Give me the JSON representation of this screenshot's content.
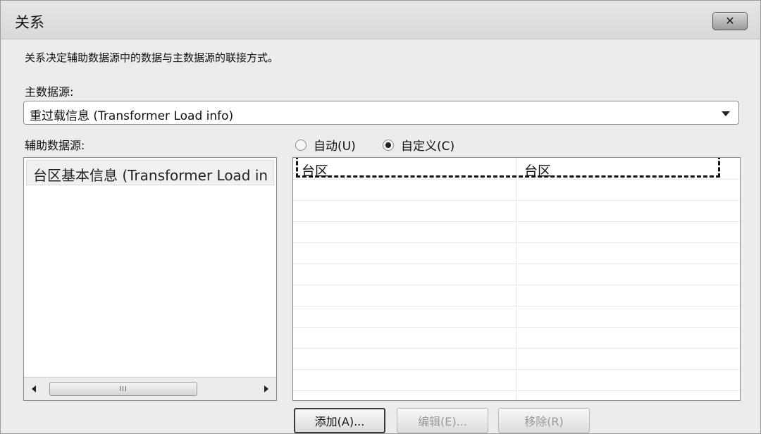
{
  "window": {
    "title": "关系",
    "close_label": "✕"
  },
  "description": "关系决定辅助数据源中的数据与主数据源的联接方式。",
  "primary_source": {
    "label": "主数据源:",
    "value": "重过载信息 (Transformer Load info)"
  },
  "secondary_source": {
    "label": "辅助数据源:",
    "items": [
      {
        "label": "台区基本信息 (Transformer Load in"
      }
    ],
    "scroll_grip": "III"
  },
  "mode": {
    "auto_label": "自动(U)",
    "custom_label": "自定义(C)",
    "selected": "custom"
  },
  "mapping": {
    "rows": [
      {
        "primary_field": "台区",
        "secondary_field": "台区"
      }
    ]
  },
  "buttons": {
    "add": "添加(A)...",
    "edit": "编辑(E)...",
    "remove": "移除(R)"
  }
}
